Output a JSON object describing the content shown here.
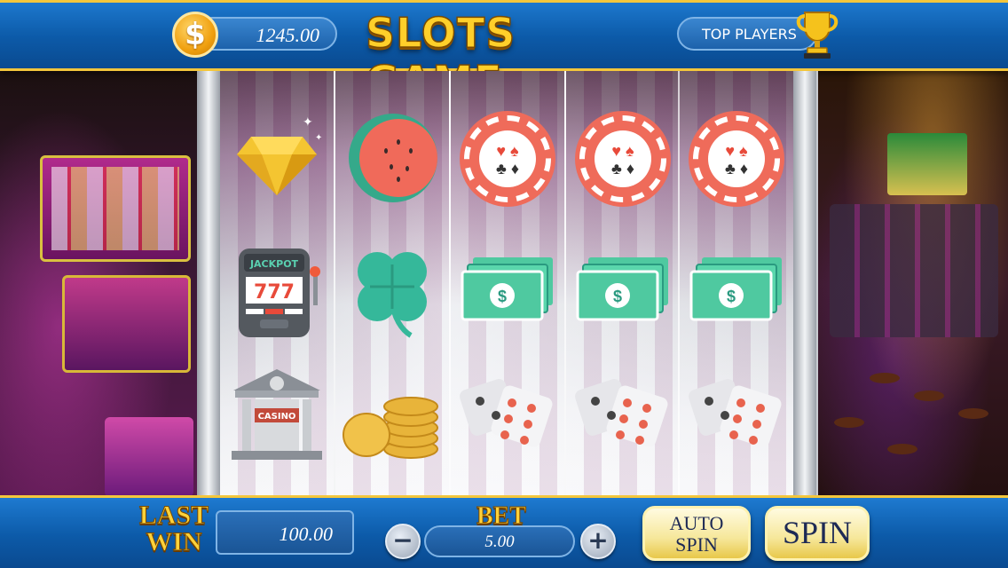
{
  "header": {
    "balance": "1245.00",
    "title": "SLOTS GAME",
    "top_players_label": "TOP PLAYERS",
    "coin_symbol": "$"
  },
  "reels": [
    {
      "symbols": [
        "diamond-icon",
        "jackpot-machine-icon",
        "casino-building-icon"
      ]
    },
    {
      "symbols": [
        "watermelon-icon",
        "clover-icon",
        "gold-coins-icon"
      ]
    },
    {
      "symbols": [
        "poker-chip-icon",
        "cash-stack-icon",
        "dice-icon"
      ]
    },
    {
      "symbols": [
        "poker-chip-icon",
        "cash-stack-icon",
        "dice-icon"
      ]
    },
    {
      "symbols": [
        "poker-chip-icon",
        "cash-stack-icon",
        "dice-icon"
      ]
    }
  ],
  "symbol_text": {
    "jackpot_label": "JACKPOT",
    "jackpot_digits": "777",
    "casino_sign": "CASINO"
  },
  "footer": {
    "last_win_label_line1": "LAST",
    "last_win_label_line2": "WIN",
    "last_win_value": "100.00",
    "bet_label": "BET",
    "bet_value": "5.00",
    "minus_label": "−",
    "plus_label": "+",
    "auto_spin_line1": "AUTO",
    "auto_spin_line2": "SPIN",
    "spin_label": "SPIN"
  },
  "colors": {
    "bar_blue": "#0c5aa8",
    "gold": "#ffcf2a",
    "chip_red": "#ef6b5a",
    "cash_green": "#4fc9a0",
    "clover_teal": "#35b89a"
  }
}
